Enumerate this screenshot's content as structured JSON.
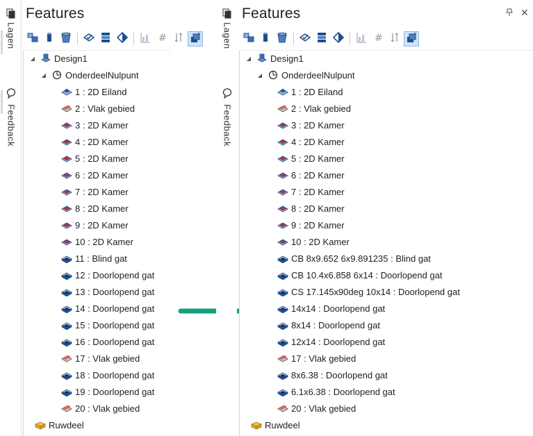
{
  "side_tabs": {
    "layers_label": "Lagen",
    "feedback_label": "Feedback"
  },
  "left": {
    "title": "Features",
    "tree": [
      {
        "label": "Design1",
        "icon": "design-icon",
        "level": 0,
        "expander": "◢"
      },
      {
        "label": "OnderdeelNulpunt",
        "icon": "origin-icon",
        "level": 1,
        "expander": "◢"
      },
      {
        "label": "1 :  2D Eiland",
        "icon": "island-icon",
        "level": 2
      },
      {
        "label": "2 :  Vlak gebied",
        "icon": "face-area-icon",
        "level": 2
      },
      {
        "label": "3 :  2D Kamer",
        "icon": "pocket-icon",
        "level": 2
      },
      {
        "label": "4 :  2D Kamer",
        "icon": "pocket-icon",
        "level": 2
      },
      {
        "label": "5 :  2D Kamer",
        "icon": "pocket-icon",
        "level": 2
      },
      {
        "label": "6 :  2D Kamer",
        "icon": "pocket-icon",
        "level": 2
      },
      {
        "label": "7 :  2D Kamer",
        "icon": "pocket-icon",
        "level": 2
      },
      {
        "label": "8 :  2D Kamer",
        "icon": "pocket-icon",
        "level": 2
      },
      {
        "label": "9 :  2D Kamer",
        "icon": "pocket-icon",
        "level": 2
      },
      {
        "label": "10 :  2D Kamer",
        "icon": "pocket-icon",
        "level": 2
      },
      {
        "label": "11 :  Blind gat",
        "icon": "hole-icon",
        "level": 2
      },
      {
        "label": "12 :  Doorlopend gat",
        "icon": "hole-icon",
        "level": 2
      },
      {
        "label": "13 :  Doorlopend gat",
        "icon": "hole-icon",
        "level": 2
      },
      {
        "label": "14 :  Doorlopend gat",
        "icon": "hole-icon",
        "level": 2
      },
      {
        "label": "15 :  Doorlopend gat",
        "icon": "hole-icon",
        "level": 2
      },
      {
        "label": "16 :  Doorlopend gat",
        "icon": "hole-icon",
        "level": 2
      },
      {
        "label": "17 :  Vlak gebied",
        "icon": "face-area-icon",
        "level": 2
      },
      {
        "label": "18 :  Doorlopend gat",
        "icon": "hole-icon",
        "level": 2
      },
      {
        "label": "19 :  Doorlopend gat",
        "icon": "hole-icon",
        "level": 2
      },
      {
        "label": "20 :  Vlak gebied",
        "icon": "face-area-icon",
        "level": 2
      },
      {
        "label": "Ruwdeel",
        "icon": "stock-icon",
        "level": 0
      }
    ]
  },
  "right": {
    "title": "Features",
    "pin_glyph": "ᵖ",
    "close_glyph": "✕",
    "tree": [
      {
        "label": "Design1",
        "icon": "design-icon",
        "level": 0,
        "expander": "◢"
      },
      {
        "label": "OnderdeelNulpunt",
        "icon": "origin-icon",
        "level": 1,
        "expander": "◢"
      },
      {
        "label": "1 :  2D Eiland",
        "icon": "island-icon",
        "level": 2
      },
      {
        "label": "2 :  Vlak gebied",
        "icon": "face-area-icon",
        "level": 2
      },
      {
        "label": "3 :  2D Kamer",
        "icon": "pocket-icon",
        "level": 2
      },
      {
        "label": "4 :  2D Kamer",
        "icon": "pocket-icon",
        "level": 2
      },
      {
        "label": "5 :  2D Kamer",
        "icon": "pocket-icon",
        "level": 2
      },
      {
        "label": "6 :  2D Kamer",
        "icon": "pocket-icon",
        "level": 2
      },
      {
        "label": "7 :  2D Kamer",
        "icon": "pocket-icon",
        "level": 2
      },
      {
        "label": "8 :  2D Kamer",
        "icon": "pocket-icon",
        "level": 2
      },
      {
        "label": "9 :  2D Kamer",
        "icon": "pocket-icon",
        "level": 2
      },
      {
        "label": "10 :  2D Kamer",
        "icon": "pocket-icon",
        "level": 2
      },
      {
        "label": "CB 8x9.652 6x9.891235 :  Blind gat",
        "icon": "hole-icon",
        "level": 2
      },
      {
        "label": "CB 10.4x6.858 6x14 :  Doorlopend gat",
        "icon": "hole-icon",
        "level": 2
      },
      {
        "label": "CS 17.145x90deg 10x14 :  Doorlopend gat",
        "icon": "hole-icon",
        "level": 2
      },
      {
        "label": "14x14 :  Doorlopend gat",
        "icon": "hole-icon",
        "level": 2
      },
      {
        "label": "8x14 :  Doorlopend gat",
        "icon": "hole-icon",
        "level": 2
      },
      {
        "label": "12x14 :  Doorlopend gat",
        "icon": "hole-icon",
        "level": 2
      },
      {
        "label": "17 :  Vlak gebied",
        "icon": "face-area-icon",
        "level": 2
      },
      {
        "label": "8x6.38 :  Doorlopend gat",
        "icon": "hole-icon",
        "level": 2
      },
      {
        "label": "6.1x6.38 :  Doorlopend gat",
        "icon": "hole-icon",
        "level": 2
      },
      {
        "label": "20 :  Vlak gebied",
        "icon": "face-area-icon",
        "level": 2
      },
      {
        "label": "Ruwdeel",
        "icon": "stock-icon",
        "level": 0
      }
    ]
  },
  "toolbar_icons": [
    "parts-icon",
    "cylinder-icon",
    "stock-cup-icon",
    "check-tool-icon",
    "layers-stack-icon",
    "diamond-icon",
    "grid-chart-icon",
    "hash-icon",
    "sort-icon",
    "features-view-icon"
  ],
  "colors": {
    "arrow": "#12a07a",
    "active_toolbar": "#cfe3f7",
    "icon_blue": "#1f4e8c",
    "pocket_red": "#c9343b"
  }
}
